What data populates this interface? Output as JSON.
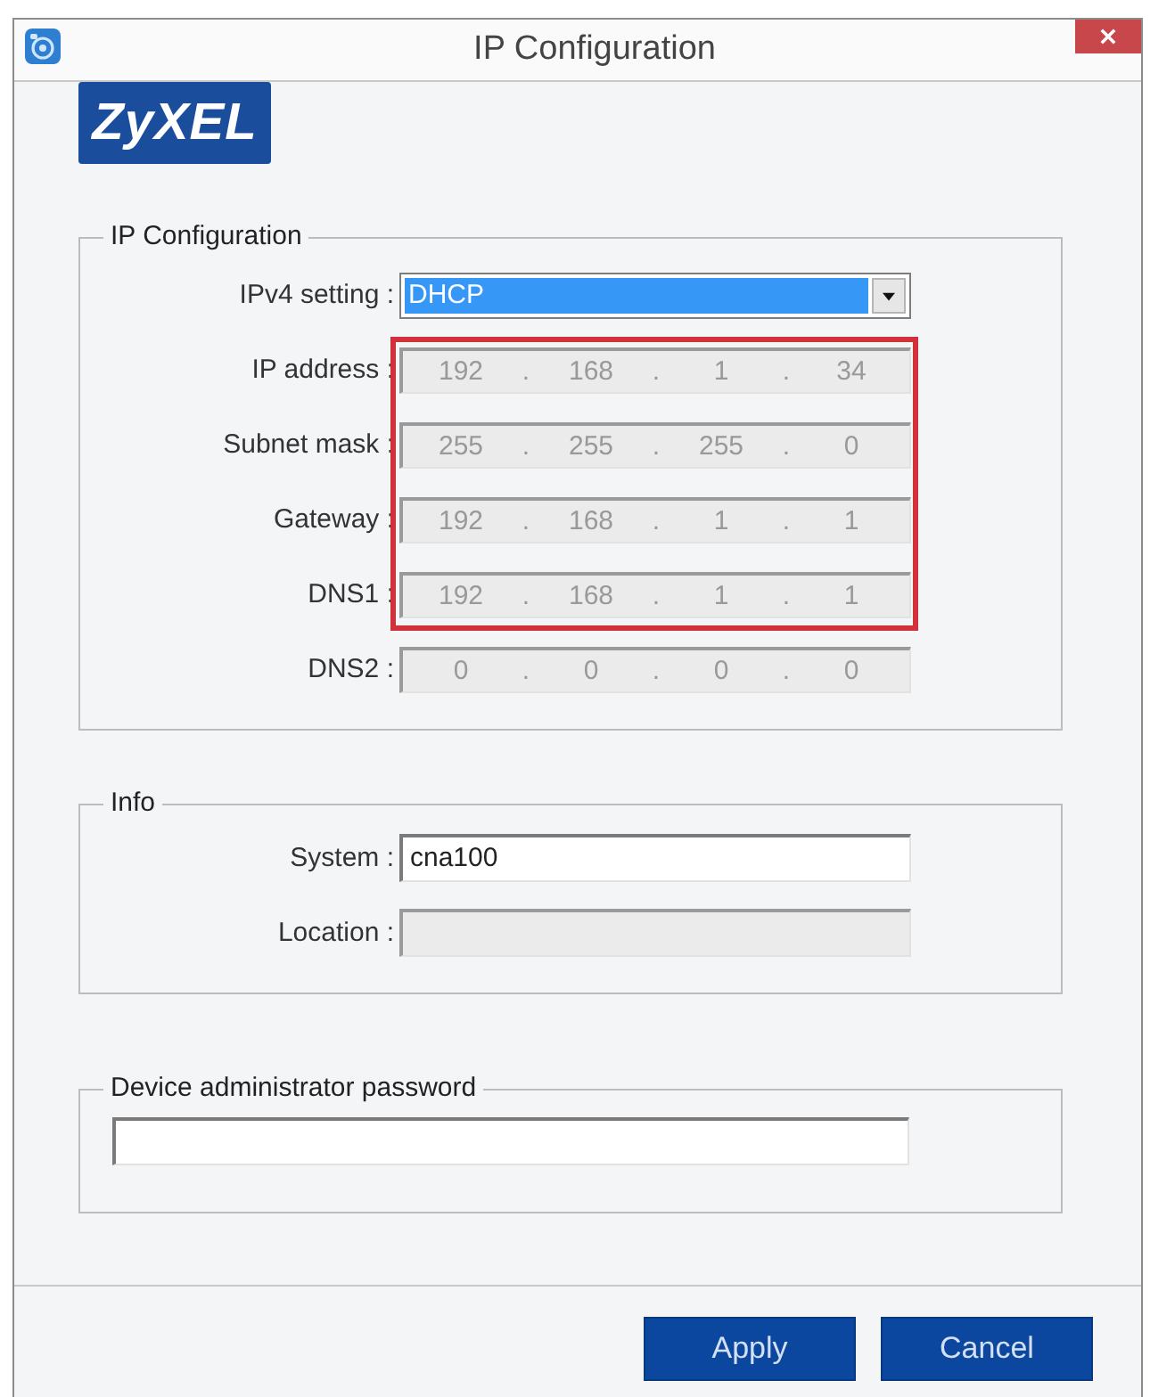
{
  "window": {
    "title": "IP Configuration"
  },
  "logo": {
    "text": "ZyXEL"
  },
  "ip_configuration": {
    "title": "IP Configuration",
    "ipv4_setting": {
      "label": "IPv4 setting :",
      "value": "DHCP",
      "focused": true
    },
    "addresses": [
      {
        "label": "IP address :",
        "value": "192 . 168 . 1 . 34",
        "disabled": true,
        "highlighted": true
      },
      {
        "label": "Subnet mask :",
        "value": "255 . 255 . 255 . 0",
        "disabled": true,
        "highlighted": true
      },
      {
        "label": "Gateway :",
        "value": "192 . 168 . 1 . 1",
        "disabled": true,
        "highlighted": true
      },
      {
        "label": "DNS1 :",
        "value": "192 . 168 . 1 . 1",
        "disabled": true,
        "highlighted": true
      },
      {
        "label": "DNS2 :",
        "value": "0 . 0 . 0 . 0",
        "disabled": true,
        "highlighted": false
      }
    ]
  },
  "info": {
    "title": "Info",
    "fields": [
      {
        "label": "System :",
        "value": "cna100",
        "disabled": false
      },
      {
        "label": "Location :",
        "disabled": true
      }
    ]
  },
  "password": {
    "title": "Device administrator password",
    "disabled": false
  },
  "buttons": [
    {
      "label": "Apply"
    },
    {
      "label": "Cancel"
    }
  ]
}
